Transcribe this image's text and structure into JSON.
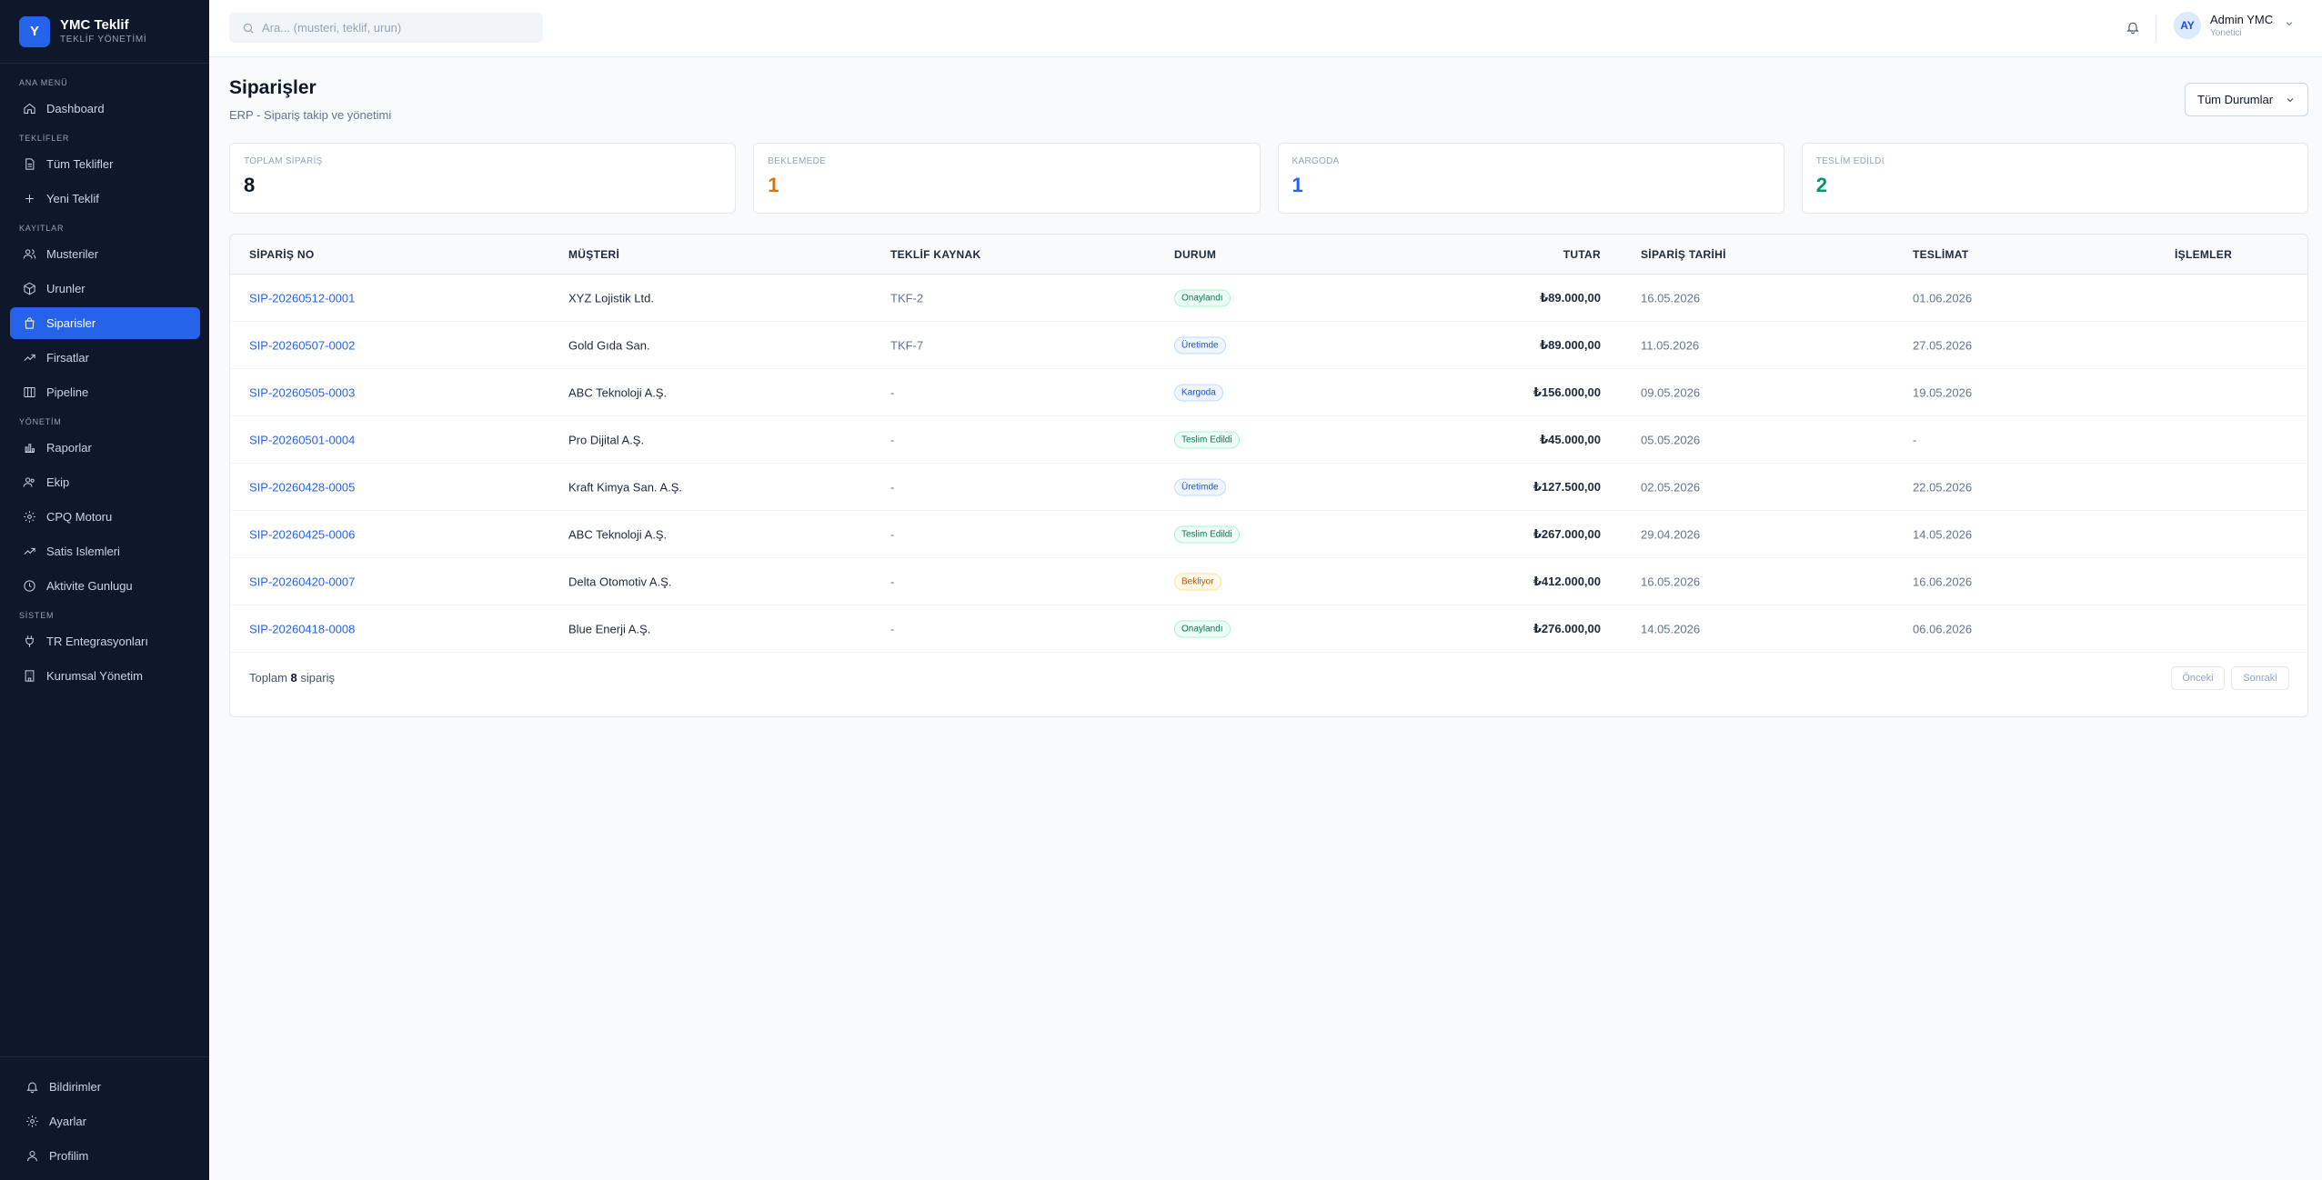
{
  "brand": {
    "logo_letter": "Y",
    "title": "YMC Teklif",
    "subtitle": "TEKLİF YÖNETİMİ"
  },
  "sidebar": {
    "sections": [
      {
        "label": "ANA MENÜ",
        "items": [
          {
            "label": "Dashboard",
            "icon": "home-icon"
          }
        ]
      },
      {
        "label": "TEKLİFLER",
        "items": [
          {
            "label": "Tüm Teklifler",
            "icon": "file-icon"
          },
          {
            "label": "Yeni Teklif",
            "icon": "plus-icon"
          }
        ]
      },
      {
        "label": "KAYITLAR",
        "items": [
          {
            "label": "Musteriler",
            "icon": "users-icon"
          },
          {
            "label": "Urunler",
            "icon": "box-icon"
          },
          {
            "label": "Siparisler",
            "icon": "bag-icon",
            "active": true
          },
          {
            "label": "Firsatlar",
            "icon": "trend-icon"
          },
          {
            "label": "Pipeline",
            "icon": "columns-icon"
          }
        ]
      },
      {
        "label": "YÖNETİM",
        "items": [
          {
            "label": "Raporlar",
            "icon": "bar-chart-icon"
          },
          {
            "label": "Ekip",
            "icon": "team-icon"
          },
          {
            "label": "CPQ Motoru",
            "icon": "gear-icon"
          },
          {
            "label": "Satis Islemleri",
            "icon": "trend-icon"
          },
          {
            "label": "Aktivite Gunlugu",
            "icon": "clock-icon"
          }
        ]
      },
      {
        "label": "SİSTEM",
        "items": [
          {
            "label": "TR Entegrasyonları",
            "icon": "plug-icon"
          },
          {
            "label": "Kurumsal Yönetim",
            "icon": "building-icon"
          }
        ]
      }
    ],
    "bottom": [
      {
        "label": "Bildirimler",
        "icon": "bell-icon"
      },
      {
        "label": "Ayarlar",
        "icon": "gear-icon"
      },
      {
        "label": "Profilim",
        "icon": "user-icon"
      }
    ]
  },
  "topbar": {
    "search_placeholder": "Ara... (musteri, teklif, urun)",
    "user": {
      "initials": "AY",
      "name": "Admin YMC",
      "role": "Yonetici"
    }
  },
  "page": {
    "title": "Siparişler",
    "subtitle": "ERP - Sipariş takip ve yönetimi",
    "status_filter": "Tüm Durumlar"
  },
  "stats": [
    {
      "label": "TOPLAM SİPARİŞ",
      "value": "8",
      "color": "#0f172a"
    },
    {
      "label": "BEKLEMEDE",
      "value": "1",
      "color": "#d97706"
    },
    {
      "label": "KARGODA",
      "value": "1",
      "color": "#2563eb"
    },
    {
      "label": "TESLİM EDİLDİ",
      "value": "2",
      "color": "#059669"
    }
  ],
  "table": {
    "columns": [
      "SİPARİŞ NO",
      "MÜŞTERİ",
      "TEKLİF KAYNAK",
      "DURUM",
      "TUTAR",
      "SİPARİŞ TARİHİ",
      "TESLİMAT",
      "İŞLEMLER"
    ],
    "rows": [
      {
        "no": "SIP-20260512-0001",
        "customer": "XYZ Lojistik Ltd.",
        "source": "TKF-2",
        "status": "Onaylandı",
        "status_kind": "green",
        "amount": "₺89.000,00",
        "order_date": "16.05.2026",
        "delivery": "01.06.2026"
      },
      {
        "no": "SIP-20260507-0002",
        "customer": "Gold Gıda San.",
        "source": "TKF-7",
        "status": "Üretimde",
        "status_kind": "blue",
        "amount": "₺89.000,00",
        "order_date": "11.05.2026",
        "delivery": "27.05.2026"
      },
      {
        "no": "SIP-20260505-0003",
        "customer": "ABC Teknoloji A.Ş.",
        "source": "-",
        "status": "Kargoda",
        "status_kind": "blue",
        "amount": "₺156.000,00",
        "order_date": "09.05.2026",
        "delivery": "19.05.2026"
      },
      {
        "no": "SIP-20260501-0004",
        "customer": "Pro Dijital A.Ş.",
        "source": "-",
        "status": "Teslim Edildi",
        "status_kind": "green",
        "amount": "₺45.000,00",
        "order_date": "05.05.2026",
        "delivery": "-"
      },
      {
        "no": "SIP-20260428-0005",
        "customer": "Kraft Kimya San. A.Ş.",
        "source": "-",
        "status": "Üretimde",
        "status_kind": "blue",
        "amount": "₺127.500,00",
        "order_date": "02.05.2026",
        "delivery": "22.05.2026"
      },
      {
        "no": "SIP-20260425-0006",
        "customer": "ABC Teknoloji A.Ş.",
        "source": "-",
        "status": "Teslim Edildi",
        "status_kind": "green",
        "amount": "₺267.000,00",
        "order_date": "29.04.2026",
        "delivery": "14.05.2026"
      },
      {
        "no": "SIP-20260420-0007",
        "customer": "Delta Otomotiv A.Ş.",
        "source": "-",
        "status": "Bekliyor",
        "status_kind": "amber",
        "amount": "₺412.000,00",
        "order_date": "16.05.2026",
        "delivery": "16.06.2026"
      },
      {
        "no": "SIP-20260418-0008",
        "customer": "Blue Enerji A.Ş.",
        "source": "-",
        "status": "Onaylandı",
        "status_kind": "green",
        "amount": "₺276.000,00",
        "order_date": "14.05.2026",
        "delivery": "06.06.2026"
      }
    ],
    "footer": {
      "prefix": "Toplam",
      "count": "8",
      "suffix": "sipariş",
      "prev_label": "Önceki",
      "next_label": "Sonraki"
    }
  }
}
